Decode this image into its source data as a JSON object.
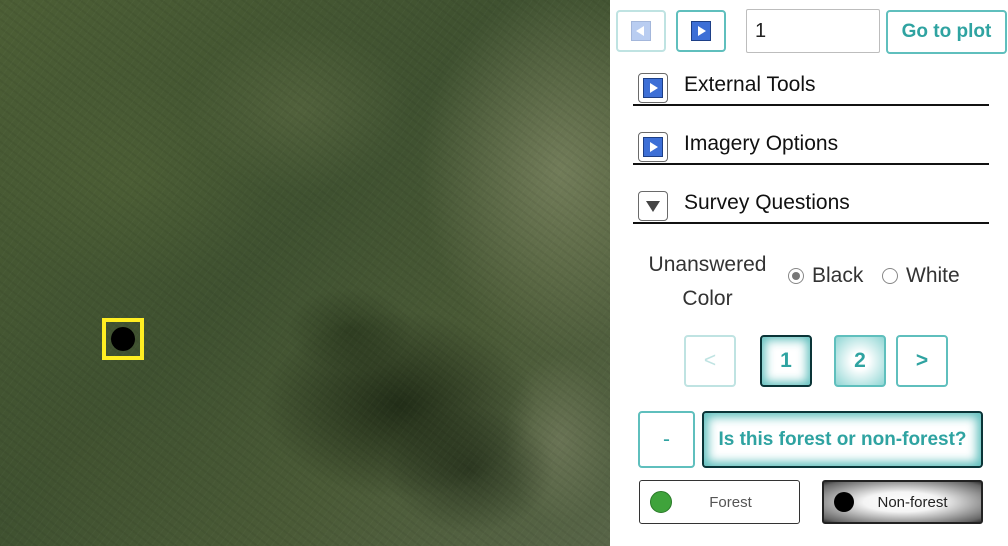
{
  "map": {
    "plot_marker_color": "#ffee22",
    "plot_dot_color": "#000000"
  },
  "navigation": {
    "prev_icon": "play-left-icon",
    "next_icon": "play-right-icon",
    "plot_input_value": "1",
    "go_button_label": "Go to plot"
  },
  "sections": [
    {
      "label": "External Tools",
      "state": "collapsed",
      "icon": "expand-arrow-icon"
    },
    {
      "label": "Imagery Options",
      "state": "collapsed",
      "icon": "expand-arrow-icon"
    },
    {
      "label": "Survey Questions",
      "state": "expanded",
      "icon": "collapse-triangle-icon"
    }
  ],
  "survey": {
    "unanswered_color_label": "Unanswered Color",
    "color_options": [
      {
        "label": "Black",
        "checked": true
      },
      {
        "label": "White",
        "checked": false
      }
    ],
    "pagination": {
      "prev_label": "<",
      "pages": [
        "1",
        "2"
      ],
      "current_page": "1",
      "next_label": ">"
    },
    "collapse_label": "-",
    "question": "Is this forest or non-forest?",
    "answers": [
      {
        "label": "Forest",
        "color": "#3fa33b"
      },
      {
        "label": "Non-forest",
        "color": "#000000"
      }
    ]
  },
  "colors": {
    "accent": "#5fbfbd",
    "accent_text": "#2fa3a1",
    "icon_blue": "#3d6fd6"
  }
}
